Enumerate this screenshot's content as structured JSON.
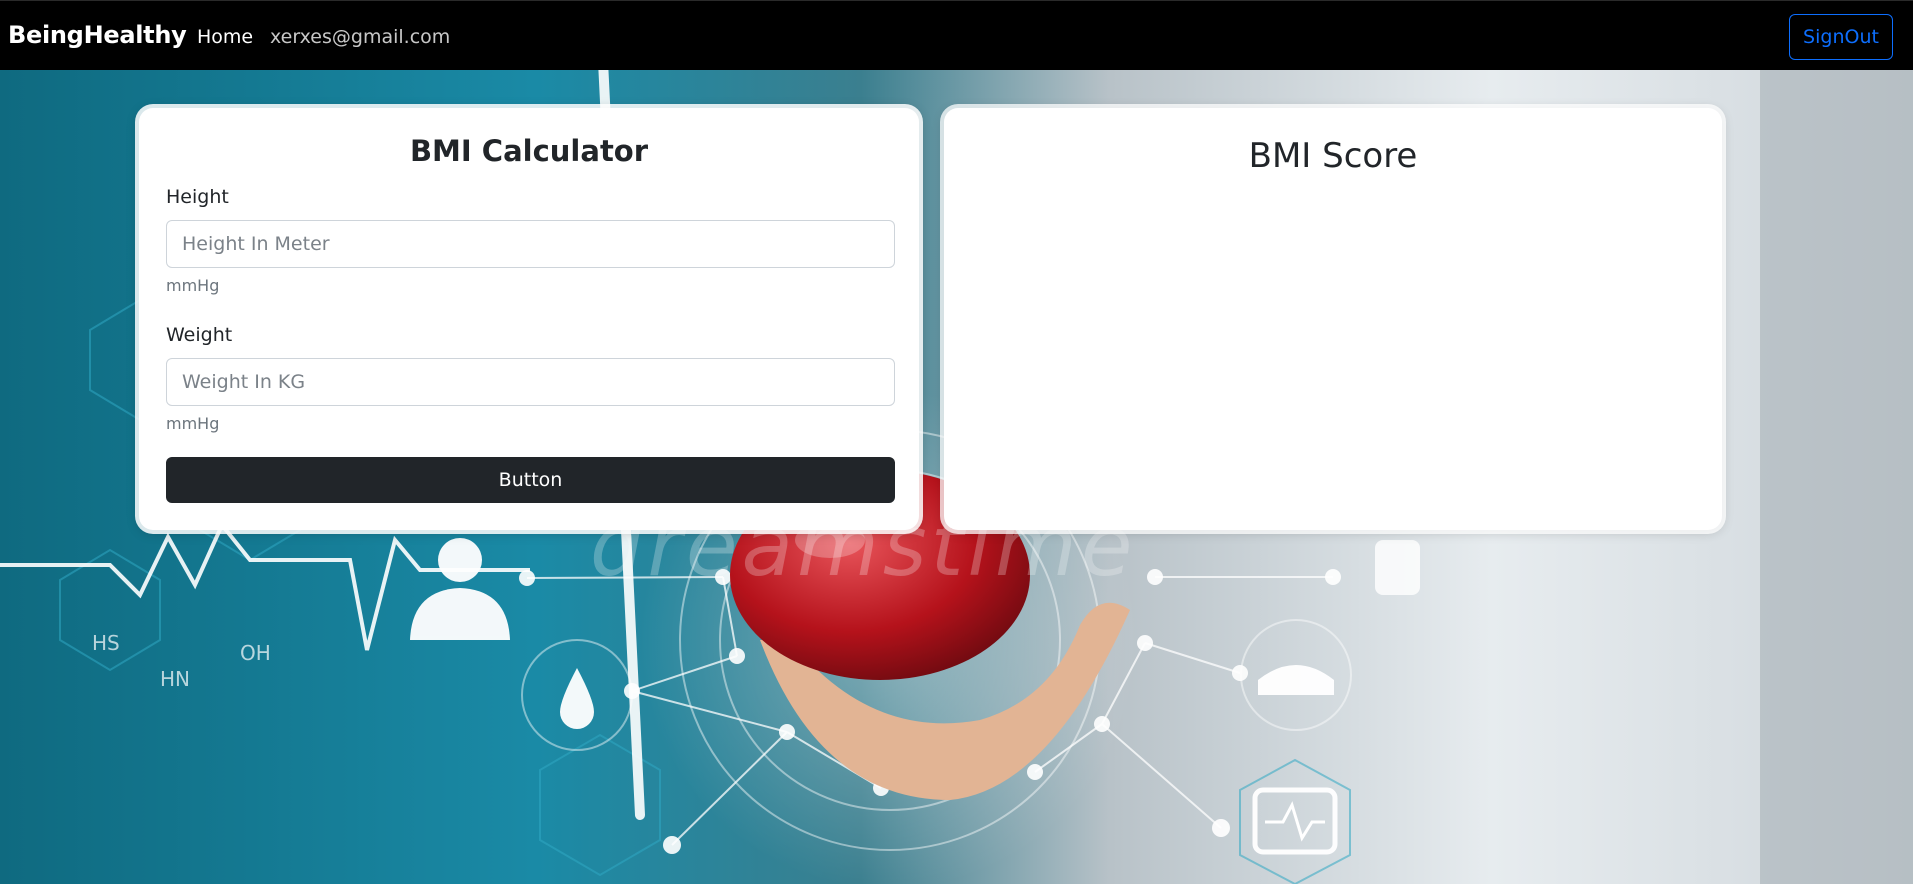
{
  "navbar": {
    "brand": "BeingHealthy",
    "home_label": "Home",
    "user_email": "xerxes@gmail.com",
    "signout_label": "SignOut"
  },
  "bmi_calculator": {
    "title": "BMI Calculator",
    "height": {
      "label": "Height",
      "value": "",
      "placeholder": "Height In Meter",
      "help": "mmHg"
    },
    "weight": {
      "label": "Weight",
      "value": "",
      "placeholder": "Weight In KG",
      "help": "mmHg"
    },
    "button_label": "Button"
  },
  "bmi_score": {
    "title": "BMI Score"
  },
  "background": {
    "watermark": "dreamstime",
    "molecule_labels": [
      "HS",
      "OH",
      "HN"
    ],
    "icons": [
      "heartbeat-line-icon",
      "doctor-icon",
      "water-drop-icon",
      "syringe-icon",
      "nurse-cap-icon",
      "iv-bag-icon",
      "monitor-icon",
      "apple-in-hand"
    ]
  },
  "colors": {
    "navbar_bg": "#000000",
    "primary": "#0d6efd",
    "dark_button": "#212529",
    "bg_teal": "#0d5d72"
  }
}
